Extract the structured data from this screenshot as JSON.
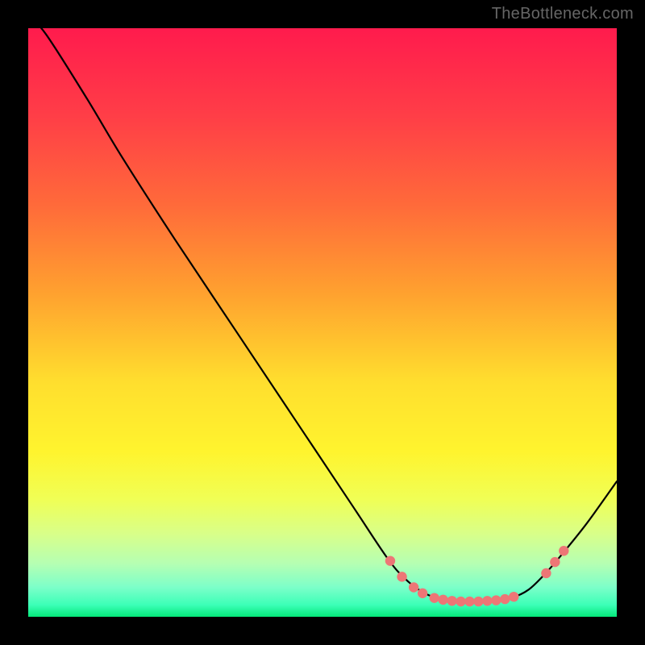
{
  "watermark": "TheBottleneck.com",
  "chart_data": {
    "type": "line",
    "title": "",
    "xlabel": "",
    "ylabel": "",
    "xlim": [
      0,
      100
    ],
    "ylim": [
      0,
      100
    ],
    "gradient_stops": [
      {
        "offset": 0,
        "color": "#ff1b4d"
      },
      {
        "offset": 15,
        "color": "#ff3e47"
      },
      {
        "offset": 30,
        "color": "#ff6a3a"
      },
      {
        "offset": 45,
        "color": "#ffa12f"
      },
      {
        "offset": 60,
        "color": "#ffde2e"
      },
      {
        "offset": 72,
        "color": "#fff42e"
      },
      {
        "offset": 80,
        "color": "#f0ff55"
      },
      {
        "offset": 86,
        "color": "#d8ff8a"
      },
      {
        "offset": 91,
        "color": "#b5ffb3"
      },
      {
        "offset": 95,
        "color": "#7cffc9"
      },
      {
        "offset": 98,
        "color": "#3bffb7"
      },
      {
        "offset": 100,
        "color": "#05e87a"
      }
    ],
    "curve": [
      {
        "x": 0,
        "y": 102
      },
      {
        "x": 3,
        "y": 99
      },
      {
        "x": 10,
        "y": 88
      },
      {
        "x": 16,
        "y": 78
      },
      {
        "x": 25,
        "y": 64
      },
      {
        "x": 35,
        "y": 49
      },
      {
        "x": 45,
        "y": 34
      },
      {
        "x": 55,
        "y": 19
      },
      {
        "x": 61,
        "y": 10
      },
      {
        "x": 64,
        "y": 6.5
      },
      {
        "x": 67,
        "y": 4.2
      },
      {
        "x": 70,
        "y": 3.0
      },
      {
        "x": 74,
        "y": 2.5
      },
      {
        "x": 78,
        "y": 2.6
      },
      {
        "x": 82,
        "y": 3.2
      },
      {
        "x": 85,
        "y": 4.6
      },
      {
        "x": 88,
        "y": 7.5
      },
      {
        "x": 91,
        "y": 11.0
      },
      {
        "x": 95,
        "y": 16.0
      },
      {
        "x": 100,
        "y": 23.0
      }
    ],
    "dots": [
      {
        "x": 61.5,
        "y": 9.5
      },
      {
        "x": 63.5,
        "y": 6.8
      },
      {
        "x": 65.5,
        "y": 5.0
      },
      {
        "x": 67.0,
        "y": 4.0
      },
      {
        "x": 69.0,
        "y": 3.2
      },
      {
        "x": 70.5,
        "y": 2.9
      },
      {
        "x": 72.0,
        "y": 2.7
      },
      {
        "x": 73.5,
        "y": 2.6
      },
      {
        "x": 75.0,
        "y": 2.6
      },
      {
        "x": 76.5,
        "y": 2.6
      },
      {
        "x": 78.0,
        "y": 2.7
      },
      {
        "x": 79.5,
        "y": 2.8
      },
      {
        "x": 81.0,
        "y": 3.0
      },
      {
        "x": 82.5,
        "y": 3.4
      },
      {
        "x": 88.0,
        "y": 7.4
      },
      {
        "x": 89.5,
        "y": 9.3
      },
      {
        "x": 91.0,
        "y": 11.2
      }
    ],
    "dot_color": "#ed7676",
    "dot_radius": 6.2
  }
}
